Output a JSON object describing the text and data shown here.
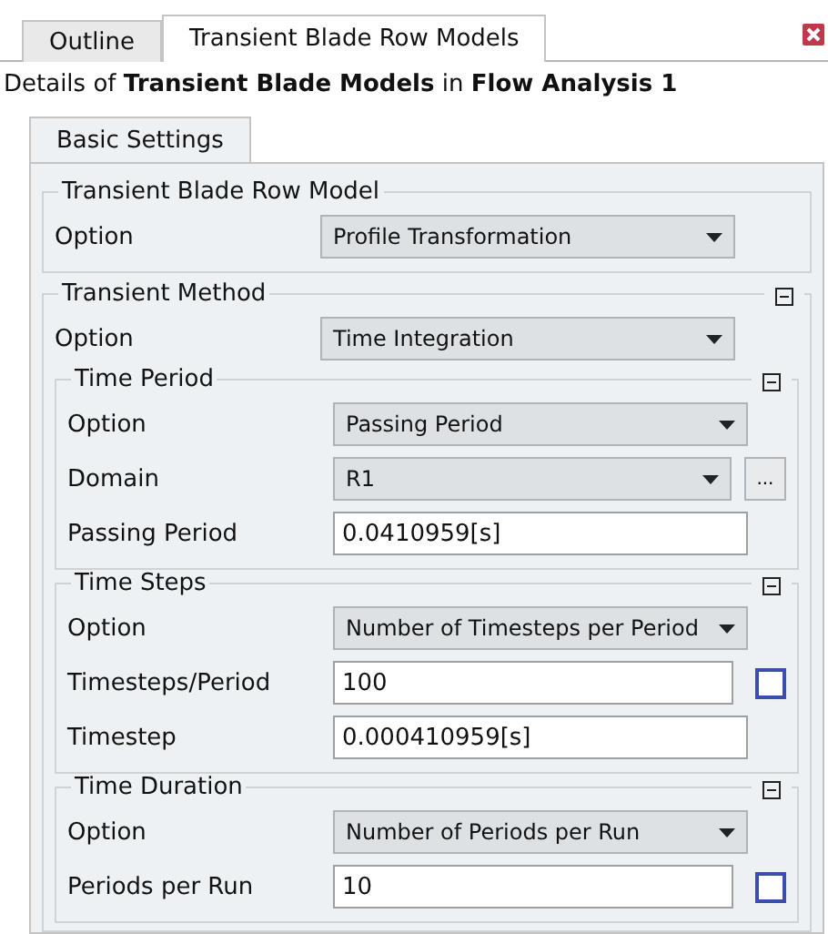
{
  "tabs": [
    {
      "label": "Outline",
      "selected": false
    },
    {
      "label": "Transient Blade Row Models",
      "selected": true
    }
  ],
  "heading": "Details of **Transient Blade Models** in **Flow Analysis 1**",
  "subtabs": [
    {
      "label": "Basic Settings",
      "selected": true
    }
  ],
  "groups": [
    {
      "title": "Transient Blade Row Model",
      "rows": [
        {
          "kind": "dropdown",
          "label": "Option",
          "value": "Profile Transformation"
        }
      ]
    },
    {
      "title": "Transient Method",
      "expanded": true,
      "rows": [
        {
          "kind": "dropdown",
          "label": "Option",
          "value": "Time Integration"
        }
      ],
      "children": [
        {
          "title": "Time Period",
          "expanded": true,
          "rows": [
            {
              "kind": "dropdown",
              "label": "Option",
              "value": "Passing Period"
            },
            {
              "kind": "dropdown",
              "label": "Domain",
              "value": "R1",
              "button": "..."
            },
            {
              "kind": "input",
              "label": "Passing Period",
              "value": "0.0410959[s]"
            }
          ]
        },
        {
          "title": "Time Steps",
          "expanded": true,
          "rows": [
            {
              "kind": "dropdown",
              "label": "Option",
              "value": "Number of Timesteps per Period"
            },
            {
              "kind": "input",
              "label": "Timesteps/Period",
              "value": "100",
              "checked": false
            },
            {
              "kind": "input",
              "label": "Timestep",
              "value": "0.000410959[s]"
            }
          ]
        },
        {
          "title": "Time Duration",
          "expanded": true,
          "rows": [
            {
              "kind": "dropdown",
              "label": "Option",
              "value": "Number of Periods per Run"
            },
            {
              "kind": "input",
              "label": "Periods per Run",
              "value": "10",
              "checked": false
            }
          ]
        }
      ]
    }
  ]
}
